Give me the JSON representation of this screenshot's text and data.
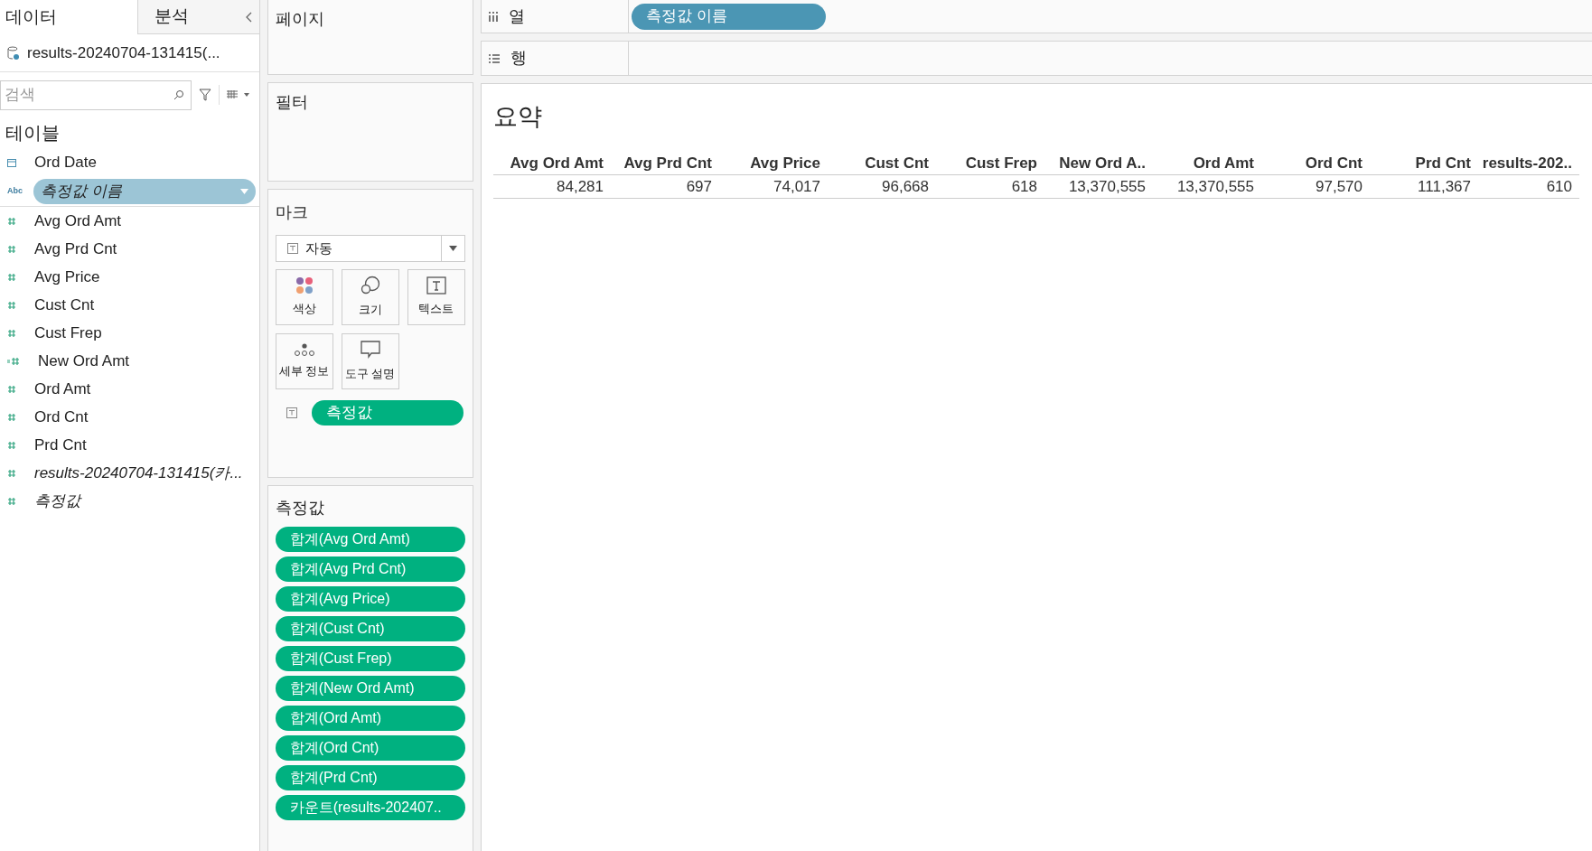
{
  "sidebar": {
    "tabs": [
      {
        "label": "데이터",
        "selected": true
      },
      {
        "label": "분석",
        "selected": false
      }
    ],
    "data_source": "results-20240704-131415(...",
    "search": {
      "placeholder": "검색"
    },
    "section_title": "테이블",
    "fields": [
      {
        "kind": "date",
        "label": "Ord Date",
        "selected": false
      },
      {
        "kind": "dimension",
        "type_badge": "Abc",
        "label": "측정값 이름",
        "selected": true
      },
      {
        "kind": "measure",
        "label": "Avg Ord Amt",
        "selected": false
      },
      {
        "kind": "measure",
        "label": "Avg Prd Cnt",
        "selected": false
      },
      {
        "kind": "measure",
        "label": "Avg Price",
        "selected": false
      },
      {
        "kind": "measure",
        "label": "Cust Cnt",
        "selected": false
      },
      {
        "kind": "measure",
        "label": "Cust Frep",
        "selected": false
      },
      {
        "kind": "calculated",
        "label": "New Ord Amt",
        "selected": false
      },
      {
        "kind": "measure",
        "label": "Ord Amt",
        "selected": false
      },
      {
        "kind": "measure",
        "label": "Ord Cnt",
        "selected": false
      },
      {
        "kind": "measure",
        "label": "Prd Cnt",
        "selected": false
      },
      {
        "kind": "generated",
        "label": "results-20240704-131415(카...",
        "selected": false
      },
      {
        "kind": "generated",
        "label": "측정값",
        "selected": false
      }
    ]
  },
  "pages_card": {
    "title": "페이지"
  },
  "filters_card": {
    "title": "필터"
  },
  "marks_card": {
    "title": "마크",
    "mark_type": "자동",
    "buttons": [
      {
        "kind": "color",
        "label": "색상"
      },
      {
        "kind": "size",
        "label": "크기"
      },
      {
        "kind": "text",
        "label": "텍스트"
      },
      {
        "kind": "detail",
        "label": "세부 정보"
      },
      {
        "kind": "tooltip",
        "label": "도구 설명"
      }
    ],
    "pill": "측정값"
  },
  "measures_card": {
    "title": "측정값",
    "pills": [
      "합계(Avg Ord Amt)",
      "합계(Avg Prd Cnt)",
      "합계(Avg Price)",
      "합계(Cust Cnt)",
      "합계(Cust Frep)",
      "합계(New Ord Amt)",
      "합계(Ord Amt)",
      "합계(Ord Cnt)",
      "합계(Prd Cnt)",
      "카운트(results-202407.."
    ]
  },
  "columns_shelf": {
    "label": "열",
    "pill": "측정값 이름"
  },
  "rows_shelf": {
    "label": "행"
  },
  "view": {
    "title": "요약",
    "columns": [
      "Avg Ord Amt",
      "Avg Prd Cnt",
      "Avg Price",
      "Cust Cnt",
      "Cust Frep",
      "New Ord A..",
      "Ord Amt",
      "Ord Cnt",
      "Prd Cnt",
      "results-202.."
    ],
    "values": [
      "84,281",
      "697",
      "74,017",
      "96,668",
      "618",
      "13,370,555",
      "13,370,555",
      "97,570",
      "111,367",
      "610"
    ]
  }
}
